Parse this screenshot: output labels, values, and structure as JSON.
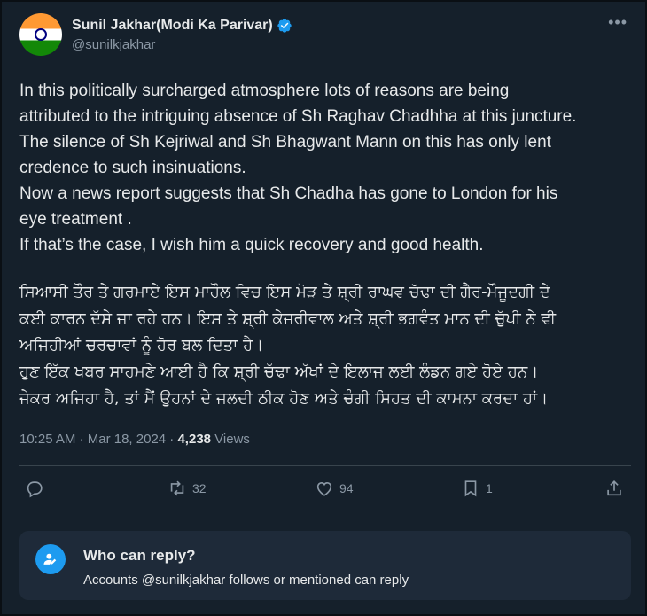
{
  "author": {
    "display_name": "Sunil Jakhar(Modi Ka Parivar)",
    "handle": "@sunilkjakhar"
  },
  "tweet": {
    "english_text": "In this politically surcharged atmosphere lots of reasons are being\nattributed to the intriguing absence of Sh Raghav Chadhha at this juncture.\nThe silence of Sh Kejriwal and Sh Bhagwant Mann on this has only lent\ncredence to such insinuations.\nNow a news report suggests that Sh Chadha has gone to London for his\neye treatment .\nIf that’s the case, I wish him a quick recovery and good health.",
    "punjabi_text": "ਸਿਆਸੀ ਤੌਰ ਤੇ ਗਰਮਾਏ ਇਸ ਮਾਹੌਲ ਵਿਚ ਇਸ ਮੋੜ ਤੇ ਸ਼੍ਰੀ ਰਾਘਵ ਚੱਢਾ ਦੀ ਗੈਰ-ਮੌਜੂਦਗੀ ਦੇ\nਕਈ ਕਾਰਨ ਦੱਸੇ ਜਾ ਰਹੇ ਹਨ। ਇਸ ਤੇ ਸ਼੍ਰੀ ਕੇਜਰੀਵਾਲ ਅਤੇ ਸ਼੍ਰੀ ਭਗਵੰਤ ਮਾਨ ਦੀ ਚੁੱਪੀ ਨੇ ਵੀ\nਅਜਿਹੀਆਂ ਚਰਚਾਵਾਂ ਨੂੰ ਹੋਰ ਬਲ ਦਿਤਾ ਹੈ।\nਹੁਣ ਇੱਕ ਖਬਰ ਸਾਹਮਣੇ ਆਈ ਹੈ ਕਿ ਸ਼੍ਰੀ ਚੱਢਾ ਅੱਖਾਂ ਦੇ ਇਲਾਜ ਲਈ ਲੰਡਨ ਗਏ ਹੋਏ ਹਨ।\nਜੇਕਰ ਅਜਿਹਾ ਹੈ, ਤਾਂ ਮੈਂ ਉਹਨਾਂ ਦੇ ਜਲਦੀ ਠੀਕ ਹੋਣ ਅਤੇ ਚੰਗੀ ਸਿਹਤ ਦੀ ਕਾਮਨਾ ਕਰਦਾ ਹਾਂ।",
    "time": "10:25 AM",
    "separator": "·",
    "date": "Mar 18, 2024",
    "views_count": "4,238",
    "views_label": "Views"
  },
  "actions": {
    "reply_count": "",
    "retweet_count": "32",
    "like_count": "94",
    "bookmark_count": "1"
  },
  "reply_settings": {
    "title": "Who can reply?",
    "description": "Accounts @sunilkjakhar follows or mentioned can reply"
  },
  "colors": {
    "background": "#15202b",
    "accent": "#1d9bf0",
    "muted_text": "#8b98a5",
    "reply_box": "#1e2a39"
  }
}
